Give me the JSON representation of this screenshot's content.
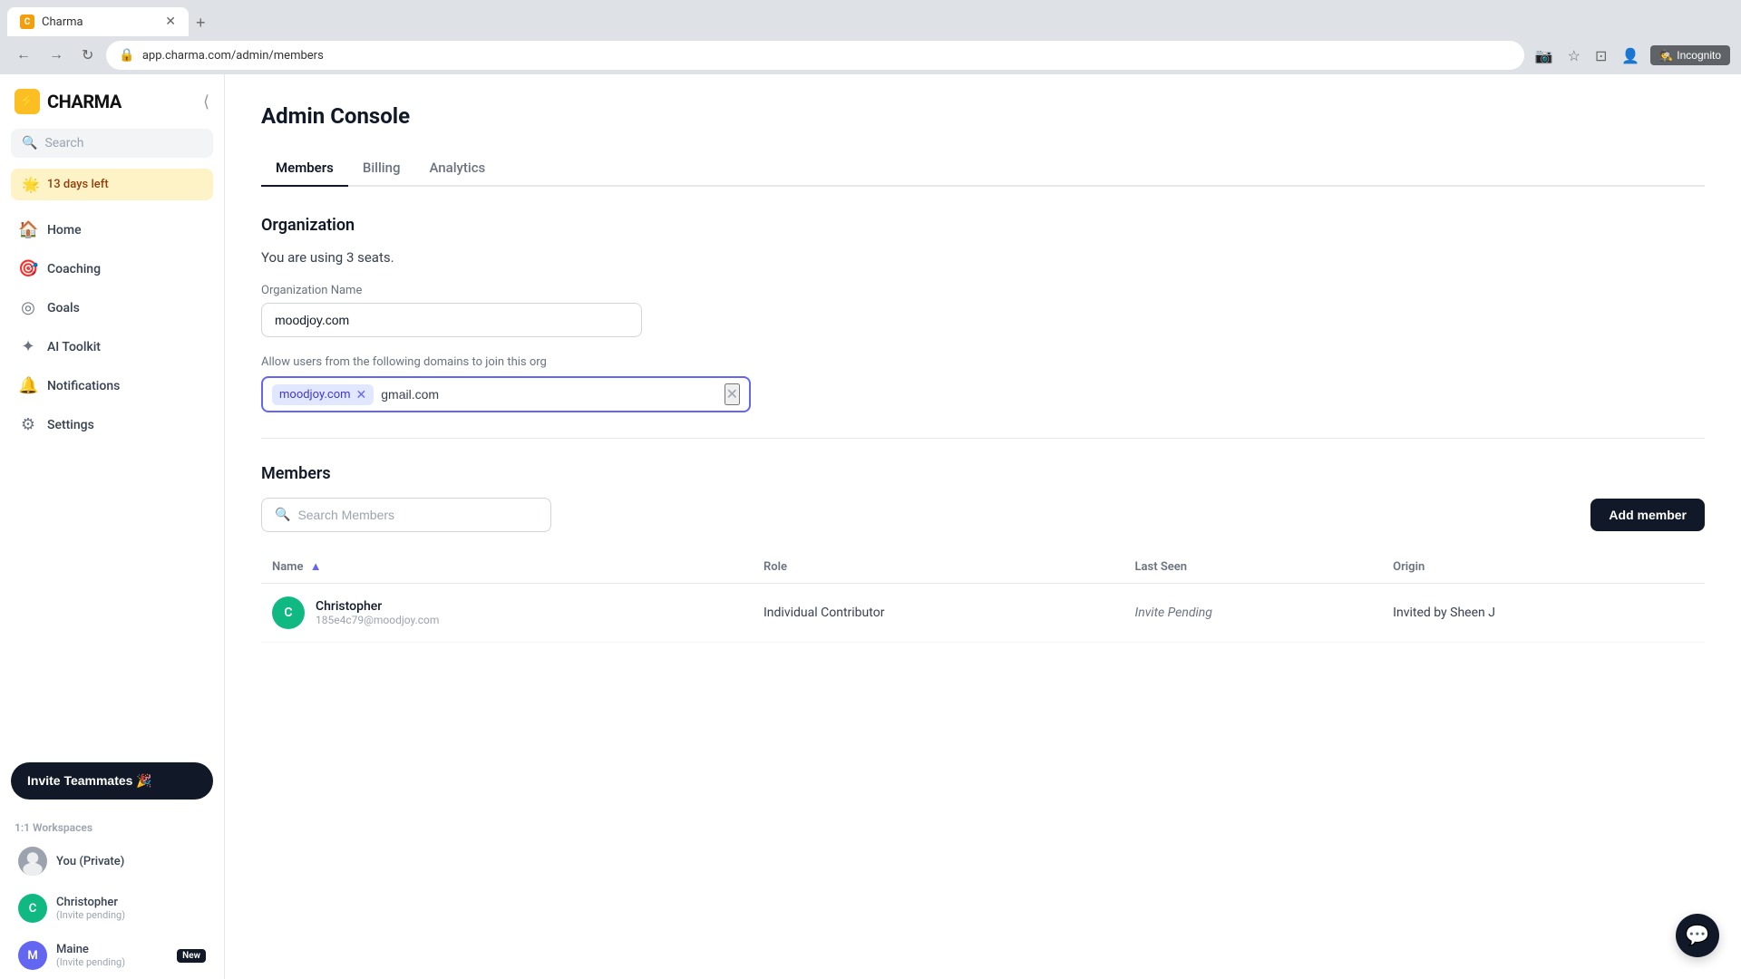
{
  "browser": {
    "tab_title": "Charma",
    "url": "app.charma.com/admin/members",
    "incognito_label": "Incognito"
  },
  "sidebar": {
    "logo_text": "CHARMA",
    "search_placeholder": "Search",
    "trial": {
      "icon": "🌟",
      "text": "13 days left"
    },
    "nav_items": [
      {
        "label": "Home",
        "icon": "🏠"
      },
      {
        "label": "Coaching",
        "icon": "🎯"
      },
      {
        "label": "Goals",
        "icon": "◎"
      },
      {
        "label": "AI Toolkit",
        "icon": "✦"
      },
      {
        "label": "Notifications",
        "icon": "🔔"
      },
      {
        "label": "Settings",
        "icon": "⚙"
      }
    ],
    "invite_button": "Invite Teammates 🎉",
    "workspaces_label": "1:1 Workspaces",
    "workspaces": [
      {
        "name": "You (Private)",
        "avatar_color": "#6b7280",
        "avatar_letter": "",
        "is_image": true,
        "sub": ""
      },
      {
        "name": "Christopher",
        "sub": "(Invite pending)",
        "avatar_color": "#10b981",
        "avatar_letter": "C",
        "badge": ""
      },
      {
        "name": "Maine",
        "sub": "(Invite pending)",
        "avatar_color": "#6366f1",
        "avatar_letter": "M",
        "badge": "New"
      }
    ]
  },
  "main": {
    "page_title": "Admin Console",
    "tabs": [
      {
        "label": "Members",
        "active": true
      },
      {
        "label": "Billing",
        "active": false
      },
      {
        "label": "Analytics",
        "active": false
      }
    ],
    "organization": {
      "section_title": "Organization",
      "seats_text": "You are using 3 seats.",
      "org_name_label": "Organization Name",
      "org_name_value": "moodjoy.com",
      "domains_label": "Allow users from the following domains to join this org",
      "domains": [
        "moodjoy.com"
      ],
      "domain_input_value": "gmail.com"
    },
    "members": {
      "section_title": "Members",
      "search_placeholder": "Search Members",
      "add_member_btn": "Add member",
      "table_headers": [
        {
          "label": "Name",
          "sortable": true
        },
        {
          "label": "Role",
          "sortable": false
        },
        {
          "label": "Last Seen",
          "sortable": false
        },
        {
          "label": "Origin",
          "sortable": false
        }
      ],
      "rows": [
        {
          "name": "Christopher",
          "email": "185e4c79@moodjoy.com",
          "role": "Individual Contributor",
          "last_seen": "Invite Pending",
          "origin": "Invited by Sheen J",
          "avatar_color": "#10b981",
          "avatar_letter": "C"
        }
      ]
    }
  }
}
